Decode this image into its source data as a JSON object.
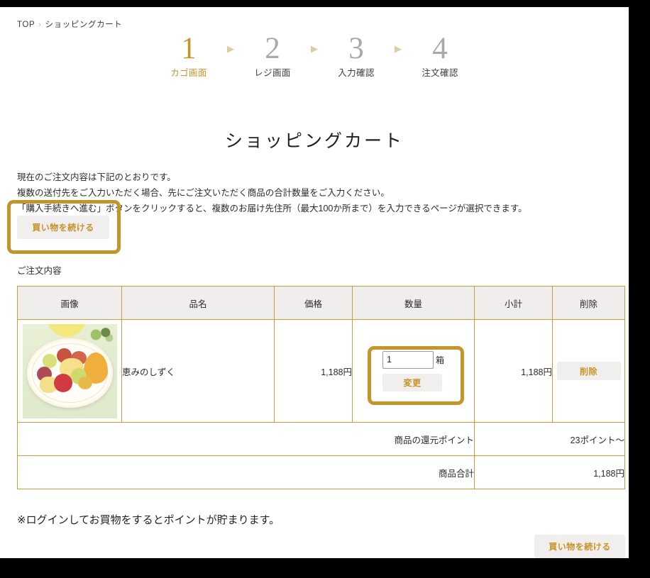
{
  "breadcrumb": {
    "home_label": "TOP",
    "separator": "›",
    "current_label": "ショッピングカート"
  },
  "steps": {
    "arrow_glyph": "▶",
    "items": [
      {
        "number": "1",
        "label": "カゴ画面",
        "active": true
      },
      {
        "number": "2",
        "label": "レジ画面",
        "active": false
      },
      {
        "number": "3",
        "label": "入力確認",
        "active": false
      },
      {
        "number": "4",
        "label": "注文確認",
        "active": false
      }
    ]
  },
  "page_title": "ショッピングカート",
  "intro": {
    "line1": "現在のご注文内容は下記のとおりです。",
    "line2": "複数の送付先をご入力いただく場合、先にご注文いただく商品の合計数量をご入力ください。",
    "line3": "「購入手続きへ進む」ボタンをクリックすると、複数のお届け先住所（最大100か所まで）を入力できるページが選択できます。"
  },
  "continue_shopping_top_label": "買い物を続ける",
  "section_label": "ご注文内容",
  "table": {
    "headers": [
      "画像",
      "品名",
      "価格",
      "数量",
      "小計",
      "削除"
    ],
    "rows": [
      {
        "image_alt": "恵みのしずく",
        "name": "恵みのしずく",
        "price": "1,188円",
        "quantity_value": "1",
        "quantity_unit": "箱",
        "change_label": "変更",
        "subtotal": "1,188円",
        "delete_label": "削除"
      }
    ],
    "summary": [
      {
        "label": "商品の還元ポイント",
        "value": "23ポイント〜"
      },
      {
        "label": "商品合計",
        "value": "1,188円"
      }
    ]
  },
  "footnote": "※ログインしてお買物をするとポイントが貯まります。",
  "continue_shopping_bottom_label": "買い物を続ける",
  "colors": {
    "accent_gold": "#c6942a",
    "table_border": "#c79e3f",
    "header_bg": "#f0eeec",
    "button_bg": "#f1efed",
    "step_inactive": "#a9a9a9",
    "frame": "#000000"
  }
}
